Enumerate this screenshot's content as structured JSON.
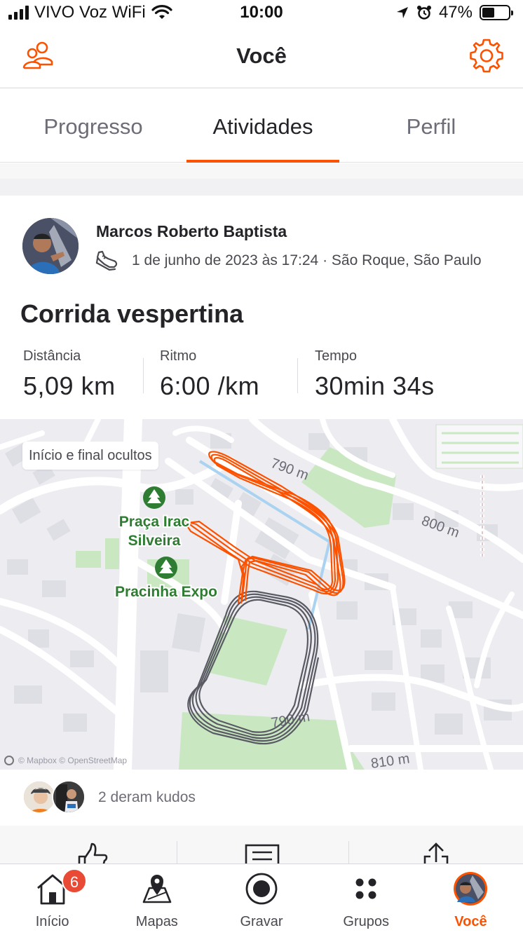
{
  "status_bar": {
    "carrier": "VIVO Voz WiFi",
    "time": "10:00",
    "battery": "47%",
    "battery_level": 0.47
  },
  "header": {
    "title": "Você",
    "friends_icon": "friends-icon",
    "settings_icon": "gear-icon"
  },
  "tabs": [
    {
      "label": "Progresso",
      "active": false
    },
    {
      "label": "Atividades",
      "active": true
    },
    {
      "label": "Perfil",
      "active": false
    }
  ],
  "activity": {
    "athlete_name": "Marcos Roberto Baptista",
    "sport_icon": "running-shoe-icon",
    "datetime_location": "1 de junho de 2023 às 17:24 · São Roque, São Paulo",
    "title": "Corrida vespertina",
    "stats": [
      {
        "label": "Distância",
        "value": "5,09 km"
      },
      {
        "label": "Ritmo",
        "value": "6:00 /km"
      },
      {
        "label": "Tempo",
        "value": "30min 34s"
      }
    ]
  },
  "map": {
    "privacy_badge": "Início e final ocultos",
    "parks": [
      "Praça Iracy Silveira",
      "Pracinha Expo"
    ],
    "park_label_1_line1": "Praça Irac",
    "park_label_1_line2": "Silveira",
    "park_label_2": "Pracinha Expo",
    "elevation_labels": [
      "790 m",
      "790 m",
      "810 m",
      "800 m"
    ],
    "attribution": "© Mapbox © OpenStreetMap",
    "route_color": "#fc5200",
    "track_color": "#5a5a64"
  },
  "kudos": {
    "text": "2 deram kudos"
  },
  "actions": [
    "kudos-icon",
    "comment-icon",
    "share-icon"
  ],
  "bottom_nav": [
    {
      "label": "Início",
      "icon": "home-icon",
      "badge": "6",
      "active": false
    },
    {
      "label": "Mapas",
      "icon": "map-icon",
      "active": false
    },
    {
      "label": "Gravar",
      "icon": "record-icon",
      "active": false
    },
    {
      "label": "Grupos",
      "icon": "groups-icon",
      "active": false
    },
    {
      "label": "Você",
      "icon": "profile-avatar",
      "active": true
    }
  ],
  "colors": {
    "accent": "#fc5200",
    "text": "#242428",
    "secondary_text": "#494950",
    "park_green": "#2e7d32",
    "badge_red": "#e84a36"
  }
}
